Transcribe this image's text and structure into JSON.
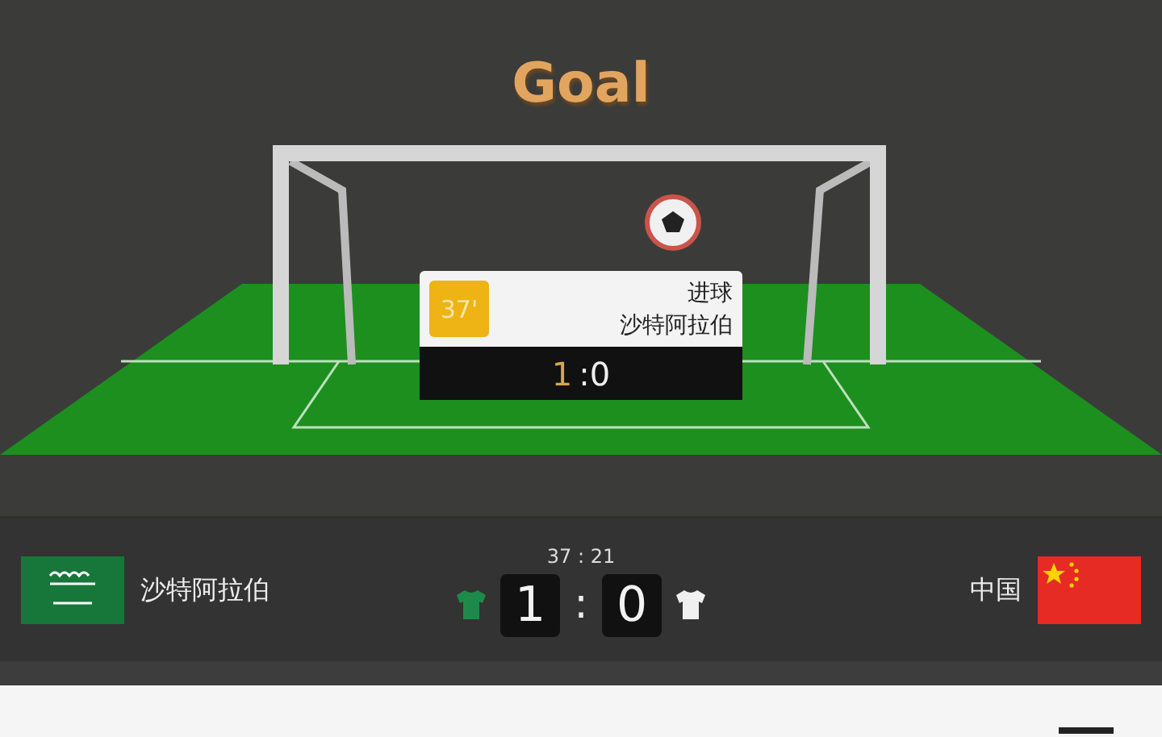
{
  "animation": {
    "title": "Goal",
    "event": {
      "minute": "37'",
      "type": "进球",
      "team": "沙特阿拉伯",
      "scorer_score": "1",
      "rest_score": ":0"
    }
  },
  "match": {
    "clock": "37 : 21",
    "home": {
      "name": "沙特阿拉伯",
      "score": "1"
    },
    "separator": ":",
    "away": {
      "name": "中国",
      "score": "0"
    }
  }
}
